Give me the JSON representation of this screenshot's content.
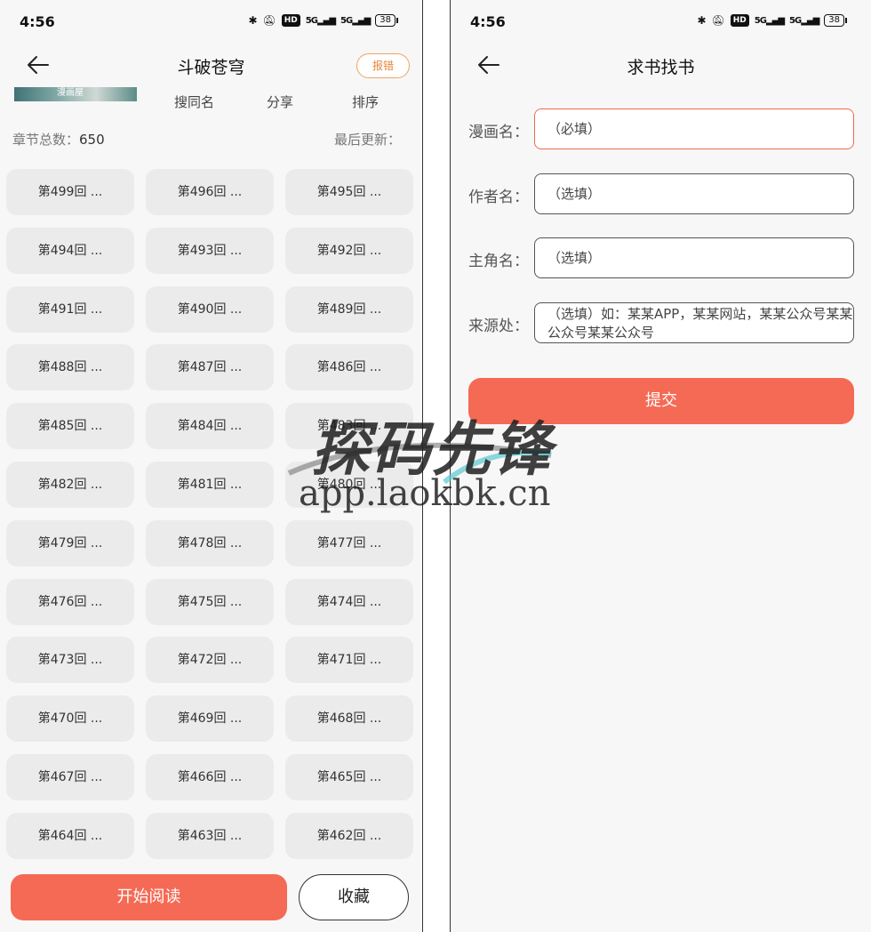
{
  "left": {
    "status": {
      "time": "4:56",
      "hd": "HD",
      "net1": "5G",
      "net2": "5G",
      "battery": "38"
    },
    "nav": {
      "title": "斗破苍穹",
      "report": "报错"
    },
    "cover_caption": "漫画屋",
    "actions": [
      "搜同名",
      "分享",
      "排序"
    ],
    "info": {
      "total_label": "章节总数：",
      "total_value": "650",
      "updated_label": "最后更新："
    },
    "chapters": [
      "第499回 ...",
      "第496回 ...",
      "第495回 ...",
      "第494回 ...",
      "第493回 ...",
      "第492回 ...",
      "第491回 ...",
      "第490回 ...",
      "第489回 ...",
      "第488回 ...",
      "第487回 ...",
      "第486回 ...",
      "第485回 ...",
      "第484回 ...",
      "第483回 ...",
      "第482回 ...",
      "第481回 ...",
      "第480回 ...",
      "第479回 ...",
      "第478回 ...",
      "第477回 ...",
      "第476回 ...",
      "第475回 ...",
      "第474回 ...",
      "第473回 ...",
      "第472回 ...",
      "第471回 ...",
      "第470回 ...",
      "第469回 ...",
      "第468回 ...",
      "第467回 ...",
      "第466回 ...",
      "第465回 ...",
      "第464回 ...",
      "第463回 ...",
      "第462回 ..."
    ],
    "buttons": {
      "read": "开始阅读",
      "favorite": "收藏"
    }
  },
  "right": {
    "status": {
      "time": "4:56",
      "hd": "HD",
      "net1": "5G",
      "net2": "5G",
      "battery": "38"
    },
    "nav": {
      "title": "求书找书"
    },
    "form": [
      {
        "label": "漫画名：",
        "placeholder": "（必填）"
      },
      {
        "label": "作者名：",
        "placeholder": "（选填）"
      },
      {
        "label": "主角名：",
        "placeholder": "（选填）"
      },
      {
        "label": "来源处：",
        "placeholder": "（选填）如：某某APP，某某网站，某某公众号某某公众号某某公众号"
      }
    ],
    "submit": "提交"
  },
  "watermark": {
    "title": "探码先锋",
    "url": "app.laokbk.cn"
  },
  "colors": {
    "accent": "#f56a55",
    "report_border": "#f0a35e",
    "chip_bg": "#ebebeb",
    "page_bg": "#f7f7f7"
  }
}
